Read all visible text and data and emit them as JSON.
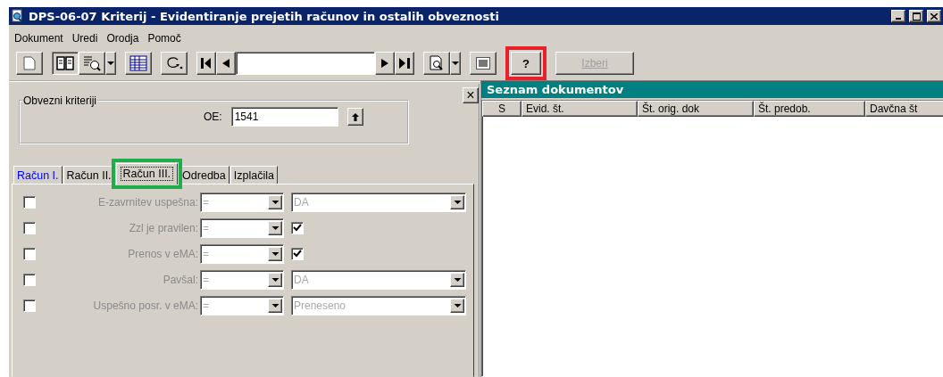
{
  "window": {
    "title": "DPS-06-07 Kriterij - Evidentiranje prejetih računov in ostalih obveznosti"
  },
  "menu": [
    "Dokument",
    "Uredi",
    "Orodja",
    "Pomoč"
  ],
  "toolbar": [
    {
      "kind": "new"
    },
    {
      "kind": "gap"
    },
    {
      "kind": "book",
      "pressed": true
    },
    {
      "kind": "find"
    },
    {
      "kind": "arrow"
    },
    {
      "kind": "gap"
    },
    {
      "kind": "table"
    },
    {
      "kind": "gap"
    },
    {
      "kind": "redo"
    },
    {
      "kind": "gap"
    },
    {
      "kind": "first"
    },
    {
      "kind": "prev"
    },
    {
      "kind": "field"
    },
    {
      "kind": "next"
    },
    {
      "kind": "last"
    },
    {
      "kind": "gap"
    },
    {
      "kind": "preview"
    },
    {
      "kind": "arrow"
    },
    {
      "kind": "gap"
    },
    {
      "kind": "export"
    },
    {
      "kind": "gap"
    },
    {
      "kind": "help",
      "label": "?",
      "highlighted": true
    },
    {
      "kind": "gap"
    },
    {
      "kind": "text",
      "label": "Izberi",
      "disabled": true
    }
  ],
  "left_panel": {
    "close": "×",
    "group": {
      "title": "Obvezni kriteriji",
      "label": "OE:",
      "value": "1541"
    },
    "tabs": [
      {
        "label": "Račun I.",
        "selected": false,
        "color": "#0000ff",
        "highlighted": false
      },
      {
        "label": "Račun II.",
        "selected": false,
        "color": "#000000",
        "highlighted": false
      },
      {
        "label": "Račun III.",
        "selected": true,
        "color": "#000000",
        "highlighted": true
      },
      {
        "label": "Odredba",
        "selected": false,
        "color": "#000000",
        "highlighted": false
      },
      {
        "label": "Izplačila",
        "selected": false,
        "color": "#000000",
        "highlighted": false
      }
    ],
    "criteria": [
      {
        "label": "E-zavrnitev uspešna:",
        "checked": false,
        "operator": "=",
        "kind": "dropdown",
        "value": "DA"
      },
      {
        "label": "Zzl je pravilen:",
        "checked": false,
        "operator": "=",
        "kind": "checkbox",
        "value_checked": true
      },
      {
        "label": "Prenos v eMA:",
        "checked": false,
        "operator": "=",
        "kind": "checkbox",
        "value_checked": true
      },
      {
        "label": "Pavšal:",
        "checked": false,
        "operator": "=",
        "kind": "dropdown",
        "value": "DA"
      },
      {
        "label": "Uspešno posr. v eMA:",
        "checked": false,
        "operator": "=",
        "kind": "dropdown",
        "value": "Preneseno"
      }
    ]
  },
  "document_list": {
    "title": "Seznam dokumentov",
    "columns": [
      "S",
      "Evid. št.",
      "Št. orig. dok",
      "Št. predob.",
      "Davčna št"
    ]
  }
}
